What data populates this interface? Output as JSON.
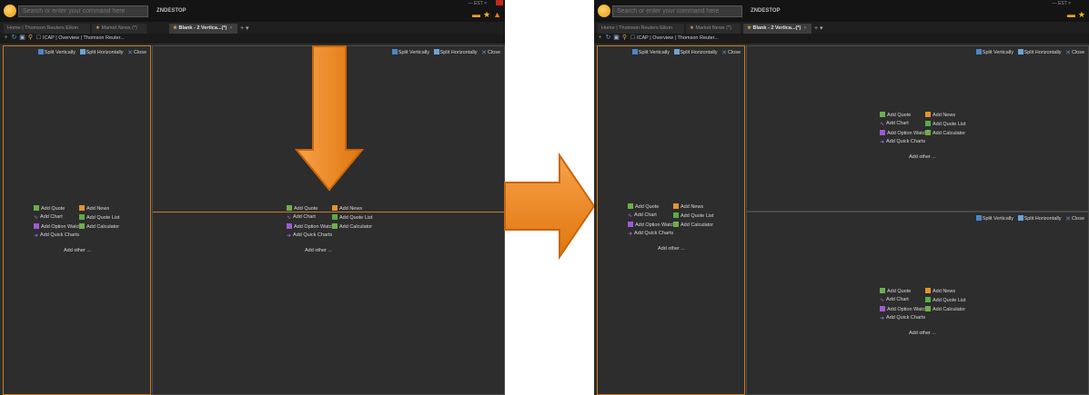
{
  "app": {
    "command_placeholder": "Search or enter your command here",
    "name": "ZNDESTOP",
    "window_controls": "—  EST  ×"
  },
  "tabs": [
    {
      "label": "Home | Thomson Reuters Eikon"
    },
    {
      "label": "Market News (*)"
    },
    {
      "label": "Blank - 2 Vertica...(*)"
    }
  ],
  "tab_add": "+ ▾",
  "tab_close": "×",
  "toolbar": {
    "doc_label": "ICAP | Overview | Thomson Reuter..."
  },
  "pane_header": {
    "split_vertically": "Split Vertically",
    "split_horizontally": "Split Horizontally",
    "close": "Close"
  },
  "add_menu": {
    "add_quote": "Add Quote",
    "add_news": "Add News",
    "add_chart": "Add Chart",
    "add_quote_list": "Add Quote List",
    "add_option_watch": "Add Option Watch",
    "add_calculator": "Add Calculator",
    "add_quick_charts": "Add Quick Charts",
    "add_other": "Add other ..."
  },
  "colors": {
    "accent_orange": "#e87d14",
    "pane_focus_border": "#c57d22",
    "background": "#2d2d2d"
  },
  "icons": [
    "search-icon",
    "message-icon",
    "star-icon",
    "warning-icon",
    "split-vertically-icon",
    "split-horizontally-icon",
    "close-icon",
    "down-arrow-annotation",
    "right-arrow-annotation"
  ]
}
